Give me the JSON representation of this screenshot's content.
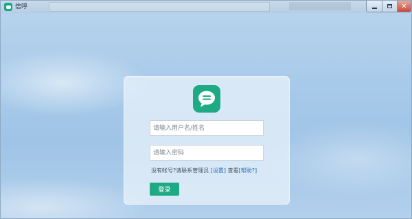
{
  "window": {
    "title": "信呼"
  },
  "login": {
    "username_placeholder": "请输入用户名/姓名",
    "password_placeholder": "请输入密码",
    "no_account_text": "没有帐号?请联系管理员",
    "settings_link": "[设置]",
    "view_text": "查看",
    "help_link": "[帮助?]",
    "login_button": "登录"
  },
  "colors": {
    "brand_green": "#1faa86",
    "link_blue": "#2f6fb3"
  },
  "icons": {
    "app": "chat-bubble-icon",
    "logo": "chat-bubble-icon",
    "minimize": "minimize-icon",
    "maximize": "maximize-icon",
    "close": "close-icon"
  }
}
